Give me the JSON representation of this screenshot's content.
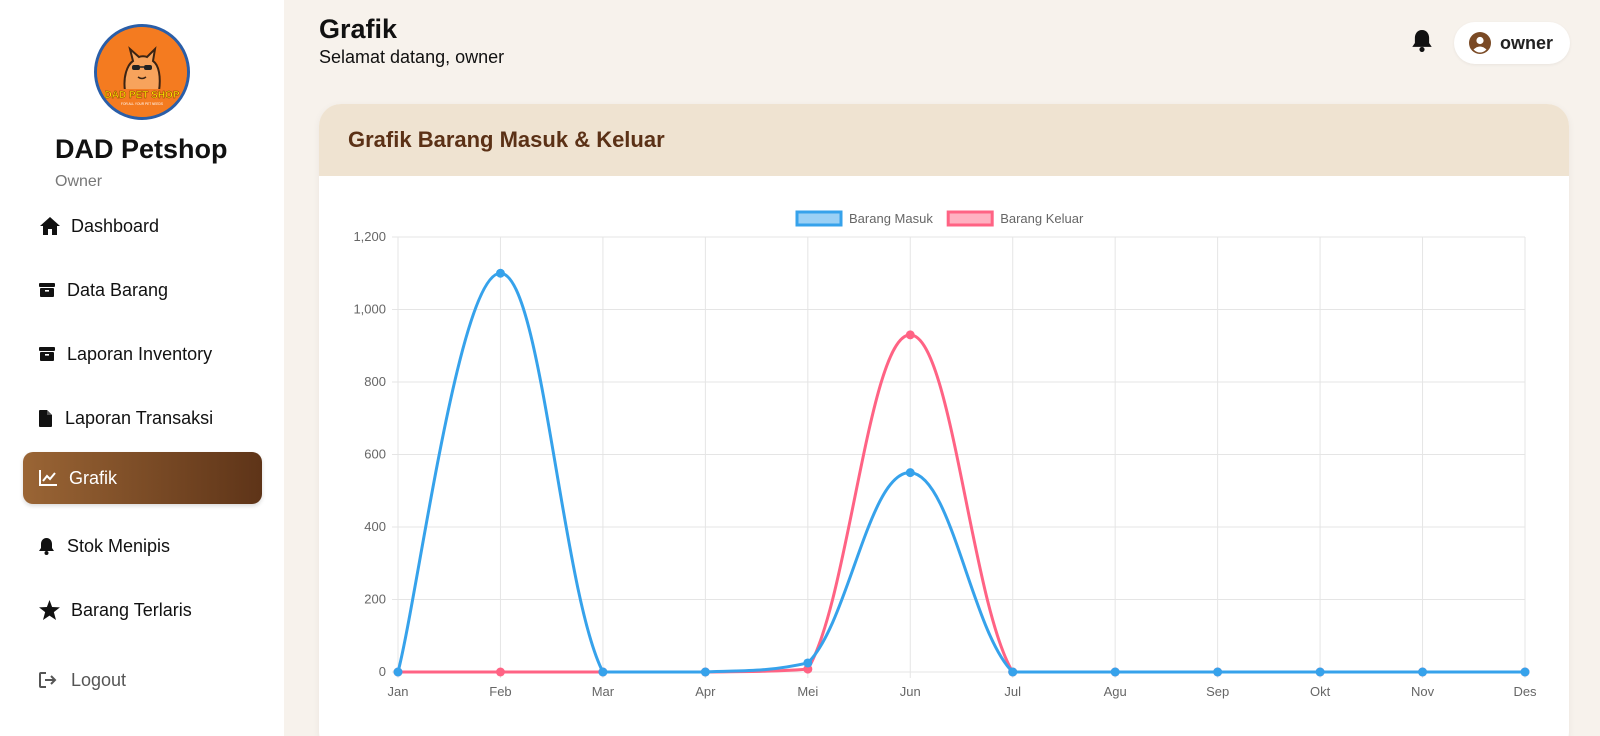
{
  "sidebar": {
    "logo_text": "DAD PET SHOP",
    "brand": "DAD Petshop",
    "role": "Owner",
    "items": [
      {
        "label": "Dashboard",
        "icon": "home-icon"
      },
      {
        "label": "Data Barang",
        "icon": "box-icon"
      },
      {
        "label": "Laporan Inventory",
        "icon": "box-icon"
      },
      {
        "label": "Laporan Transaksi",
        "icon": "file-icon"
      },
      {
        "label": "Grafik",
        "icon": "chart-line-icon",
        "active": true
      },
      {
        "label": "Stok Menipis",
        "icon": "bell-icon"
      },
      {
        "label": "Barang Terlaris",
        "icon": "star-icon"
      }
    ],
    "logout": "Logout"
  },
  "header": {
    "title": "Grafik",
    "subtitle": "Selamat datang, owner",
    "user": "owner"
  },
  "card": {
    "title": "Grafik Barang Masuk & Keluar"
  },
  "colors": {
    "accent_dark": "#5e3418",
    "accent_light": "#9a6535",
    "masuk": "#36a2eb",
    "keluar": "#ff6384"
  },
  "chart_data": {
    "type": "line",
    "categories": [
      "Jan",
      "Feb",
      "Mar",
      "Apr",
      "Mei",
      "Jun",
      "Jul",
      "Agu",
      "Sep",
      "Okt",
      "Nov",
      "Des"
    ],
    "series": [
      {
        "name": "Barang Masuk",
        "color": "#36a2eb",
        "values": [
          0,
          1100,
          0,
          0,
          25,
          550,
          0,
          0,
          0,
          0,
          0,
          0
        ]
      },
      {
        "name": "Barang Keluar",
        "color": "#ff6384",
        "values": [
          0,
          0,
          0,
          0,
          8,
          930,
          0,
          0,
          0,
          0,
          0,
          0
        ]
      }
    ],
    "ylim": [
      0,
      1200
    ],
    "yticks": [
      0,
      200,
      400,
      600,
      800,
      1000,
      1200
    ],
    "ytick_labels": [
      "0",
      "200",
      "400",
      "600",
      "800",
      "1,000",
      "1,200"
    ],
    "grid": true,
    "legend": "top-center"
  }
}
